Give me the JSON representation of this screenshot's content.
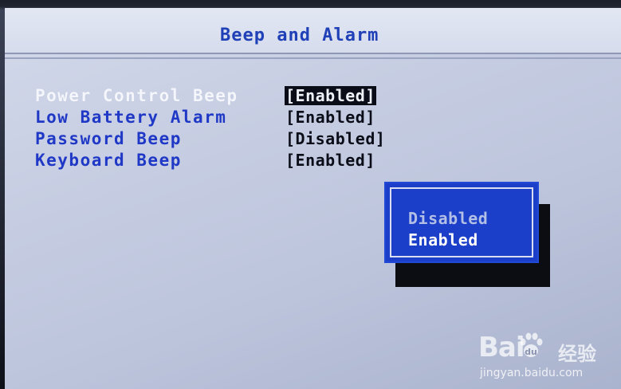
{
  "header": {
    "title": "Beep and Alarm"
  },
  "settings": [
    {
      "label": "Power Control Beep",
      "value": "[Enabled]",
      "selected": true
    },
    {
      "label": "Low Battery Alarm",
      "value": "[Enabled]",
      "selected": false
    },
    {
      "label": "Password Beep",
      "value": "[Disabled]",
      "selected": false
    },
    {
      "label": "Keyboard Beep",
      "value": "[Enabled]",
      "selected": false
    }
  ],
  "popup": {
    "options": [
      "Disabled",
      "Enabled"
    ],
    "highlighted_option": "Enabled"
  },
  "watermark": {
    "logo_prefix": "Bai",
    "logo_suffix": "",
    "cn_text": "经验",
    "url": "jingyan.baidu.com"
  },
  "colors": {
    "label_blue": "#1f38c6",
    "popup_blue": "#1b3fc8",
    "panel_bg": "#c6cde2",
    "value_text": "#0a0d18"
  }
}
